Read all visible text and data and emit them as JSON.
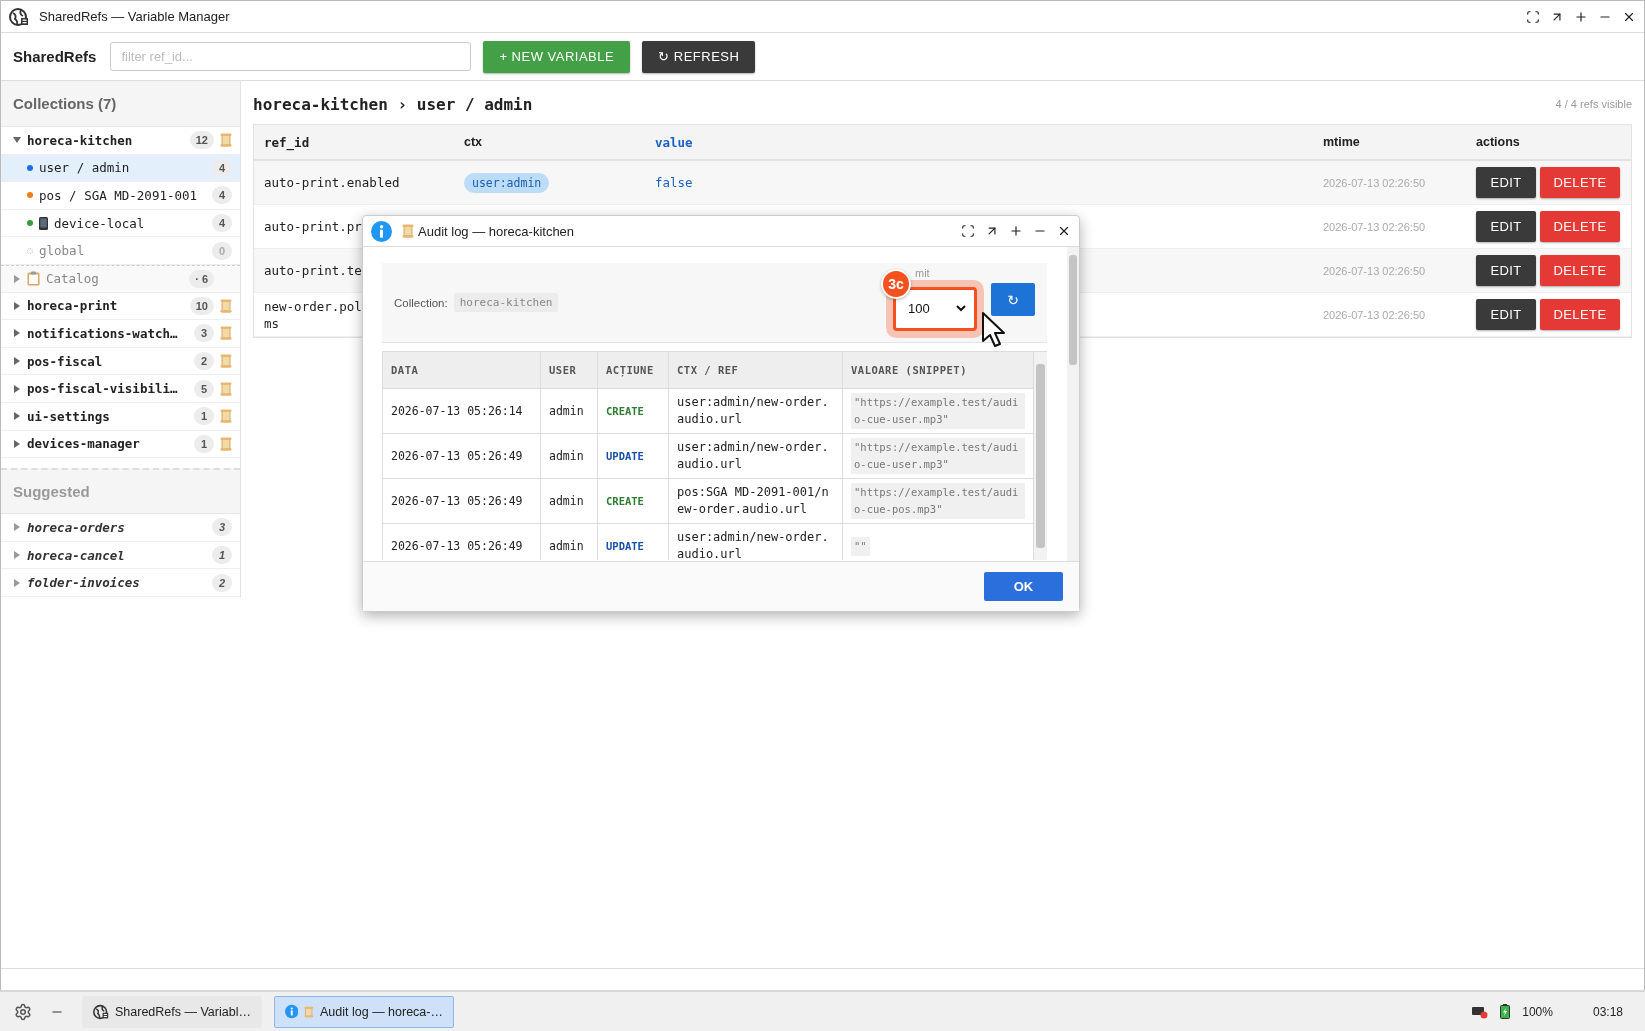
{
  "window": {
    "title": "SharedRefs — Variable Manager"
  },
  "toolbar": {
    "brand": "SharedRefs",
    "filter": {
      "placeholder": "filter ref_id..."
    },
    "buttons": [
      {
        "label": "+ NEW VARIABLE",
        "kind": "primary"
      },
      {
        "label": "↻ REFRESH",
        "kind": "dark"
      }
    ]
  },
  "sidebar": {
    "title": "Collections (7)",
    "collections": [
      {
        "name": "horeca-kitchen",
        "count": "12",
        "kind": "collection",
        "expanded": true,
        "children": [
          {
            "label": "user / admin",
            "count": "4",
            "kind": "dot",
            "color": "#1e6fd9",
            "selected": true
          },
          {
            "label": "pos / SGA MD-2091-001",
            "count": "4",
            "kind": "dot",
            "color": "#f07d1a",
            "selected": false
          },
          {
            "label": "device-local",
            "count": "4",
            "kind": "device",
            "color": "#3a9a3e",
            "selected": false
          },
          {
            "label": "global",
            "count": "0",
            "kind": "empty",
            "selected": false
          }
        ]
      },
      {
        "name": "Catalog",
        "count": "· 6",
        "kind": "catalog",
        "expanded": false
      },
      {
        "name": "horeca-print",
        "count": "10",
        "kind": "collection",
        "expanded": false
      },
      {
        "name": "notifications-watch…",
        "count": "3",
        "kind": "collection",
        "expanded": false
      },
      {
        "name": "pos-fiscal",
        "count": "2",
        "kind": "collection",
        "expanded": false
      },
      {
        "name": "pos-fiscal-visibili…",
        "count": "5",
        "kind": "collection",
        "expanded": false
      },
      {
        "name": "ui-settings",
        "count": "1",
        "kind": "collection",
        "expanded": false
      },
      {
        "name": "devices-manager",
        "count": "1",
        "kind": "collection",
        "expanded": false
      }
    ],
    "suggested_title": "Suggested",
    "suggested": [
      {
        "name": "horeca-orders",
        "count": "3"
      },
      {
        "name": "horeca-cancel",
        "count": "1"
      },
      {
        "name": "folder-invoices",
        "count": "2"
      }
    ]
  },
  "main": {
    "breadcrumb": "horeca-kitchen › user / admin",
    "visible_count": "4 / 4 refs visible",
    "table": {
      "columns": [
        {
          "label": "ref_id",
          "active": false
        },
        {
          "label": "ctx",
          "active": false
        },
        {
          "label": "value",
          "active": true
        },
        {
          "label": "mtime",
          "active": false
        },
        {
          "label": "actions",
          "active": false
        }
      ],
      "rows": [
        {
          "ref_id": "auto-print.enabled",
          "ctx": "user:admin",
          "value": "false",
          "mtime": "2026-07-13 02:26:50",
          "actions": [
            "EDIT",
            "DELETE"
          ]
        },
        {
          "ref_id": "auto-print.pr",
          "mtime": "2026-07-13 02:26:50",
          "actions": [
            "EDIT",
            "DELETE"
          ]
        },
        {
          "ref_id": "auto-print.te",
          "mtime": "2026-07-13 02:26:50",
          "actions": [
            "EDIT",
            "DELETE"
          ]
        },
        {
          "ref_id": "new-order.pol\nms",
          "mtime": "2026-07-13 02:26:50",
          "actions": [
            "EDIT",
            "DELETE"
          ]
        }
      ]
    }
  },
  "dialog": {
    "title": "Audit log — horeca-kitchen",
    "collection_label": "Collection:",
    "collection": "horeca-kitchen",
    "limit_label": "mit",
    "limit": "100",
    "reload": "↻",
    "annotation": "3c",
    "columns": [
      "DATA",
      "USER",
      "ACȚIUNE",
      "CTX / REF",
      "VALOARE (SNIPPET)"
    ],
    "rows": [
      {
        "date": "2026-07-13 05:26:14",
        "user": "admin",
        "action": "CREATE",
        "kind": "create",
        "ref": "user:admin/new-order.audio.url",
        "snippet": "\"https://example.test/audio-cue-user.mp3\""
      },
      {
        "date": "2026-07-13 05:26:49",
        "user": "admin",
        "action": "UPDATE",
        "kind": "update",
        "ref": "user:admin/new-order.audio.url",
        "snippet": "\"https://example.test/audio-cue-user.mp3\""
      },
      {
        "date": "2026-07-13 05:26:49",
        "user": "admin",
        "action": "CREATE",
        "kind": "create",
        "ref": "pos:SGA MD-2091-001/new-order.audio.url",
        "snippet": "\"https://example.test/audio-cue-pos.mp3\""
      },
      {
        "date": "2026-07-13 05:26:49",
        "user": "admin",
        "action": "UPDATE",
        "kind": "update",
        "ref": "user:admin/new-order.audio.url",
        "snippet": "\"\""
      }
    ],
    "ok": "OK"
  },
  "taskbar": {
    "windows": [
      {
        "label": "SharedRefs — Variabl…",
        "kind": "app",
        "selected": false
      },
      {
        "label": "Audit log — horeca-…",
        "kind": "dialog",
        "selected": true
      }
    ],
    "battery": "100%",
    "clock": "03:18"
  }
}
